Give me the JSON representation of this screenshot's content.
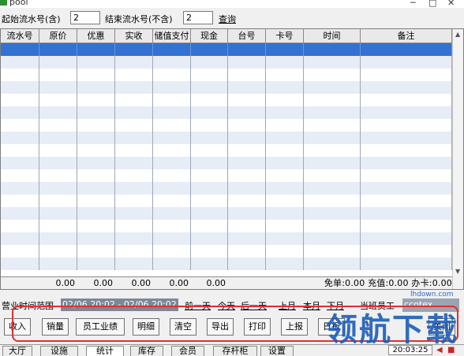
{
  "window": {
    "title": "pool",
    "controls": [
      "─",
      "□",
      "✕"
    ]
  },
  "filter": {
    "start_label": "起始流水号(含)",
    "start_value": "2",
    "end_label": "结束流水号(不含)",
    "end_value": "2",
    "query_label": "查询"
  },
  "grid": {
    "columns": [
      "流水号",
      "原价",
      "优惠",
      "实收",
      "储值支付",
      "现金",
      "台号",
      "卡号",
      "时间",
      "备注"
    ],
    "totals": [
      "",
      "0.00",
      "0.00",
      "0.00",
      "0.00",
      "0.00"
    ],
    "summary": "免单:0.00 充值:0.00 办卡:0.00"
  },
  "range_bar": {
    "label": "营业时间范围",
    "range": "02/06 20:02 - 02/06 20:02",
    "prev_day": "前一天",
    "today": "今天",
    "next_day": "后一天",
    "prev_month": "上月",
    "this_month": "本月",
    "next_month": "下月",
    "staff_label": "当班员工",
    "staff_value": "ccotex"
  },
  "actions": [
    "收入",
    "销量",
    "员工业绩",
    "明细",
    "清空",
    "导出",
    "打印",
    "上报",
    "日报",
    "关闭"
  ],
  "tabs": [
    "大厅",
    "设施",
    "统计",
    "库存",
    "会员",
    "存杆柜",
    "设置"
  ],
  "active_tab": "统计",
  "status": {
    "clock": "20:03:25"
  },
  "watermark": {
    "text": "领航下载",
    "url": "lhdown.com"
  },
  "colors": {
    "selected_row": "#3372d3",
    "alt_row": "#e7edf6",
    "highlight_frame": "#e0302f"
  }
}
